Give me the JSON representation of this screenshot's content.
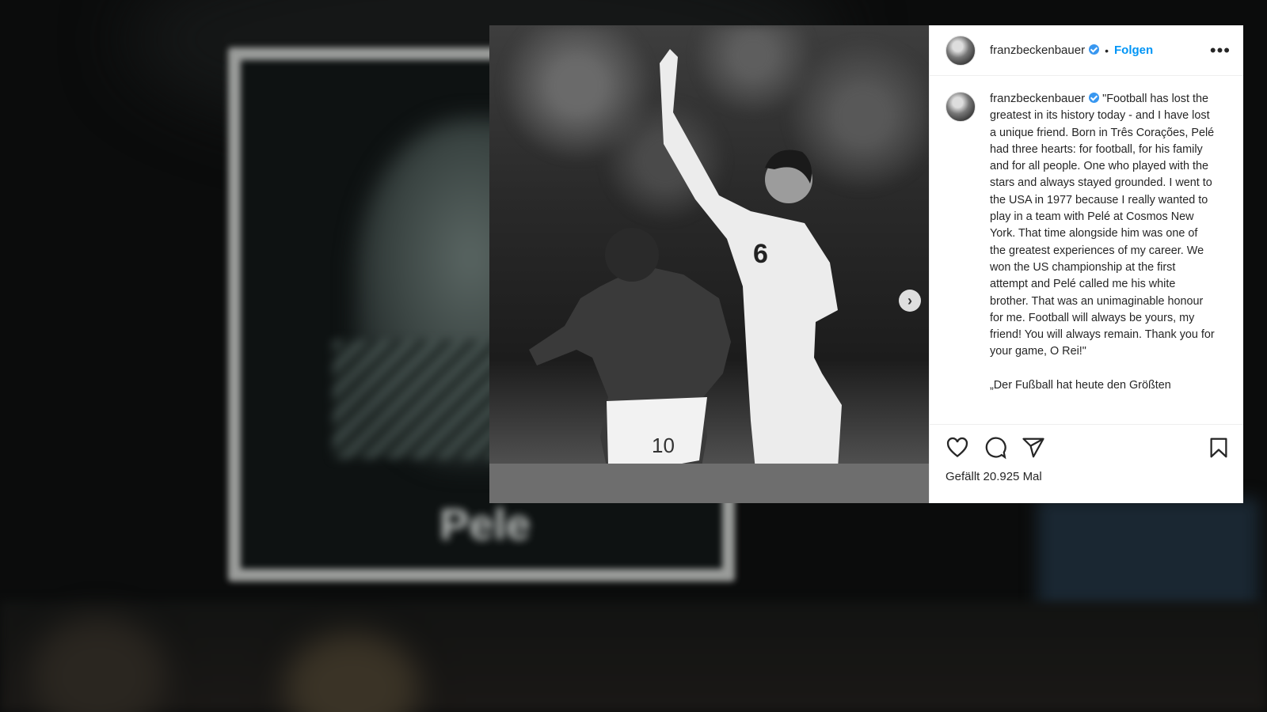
{
  "post": {
    "username": "franzbeckenbauer",
    "separator": "•",
    "follow_label": "Folgen",
    "more_label": "•••",
    "caption_user": "franzbeckenbauer",
    "caption_text": "\"Football has lost the greatest in its history today - and I have lost a unique friend. Born in Três Corações, Pelé had three hearts: for football, for his family and for all people. One who played with the stars and always stayed grounded. I went to the USA in 1977 because I really wanted to play in a team with Pelé at Cosmos New York. That time alongside him was one of the greatest experiences of my career. We won the US championship at the first attempt and Pelé called me his white brother. That was an unimaginable honour for me. Football will always be yours, my friend! You will always remain. Thank you for your game, O Rei!\"",
    "caption_second": "„Der Fußball hat heute den Größten",
    "likes": "Gefällt 20.925 Mal",
    "next_label": "›"
  },
  "background": {
    "screen_text": "Pele"
  },
  "icons": {
    "verified": "verified-badge-icon",
    "like": "heart-icon",
    "comment": "comment-icon",
    "share": "paper-plane-icon",
    "save": "bookmark-icon",
    "next": "chevron-right-icon"
  },
  "colors": {
    "follow": "#0095f6",
    "verified": "#3897f0",
    "text": "#262626"
  }
}
